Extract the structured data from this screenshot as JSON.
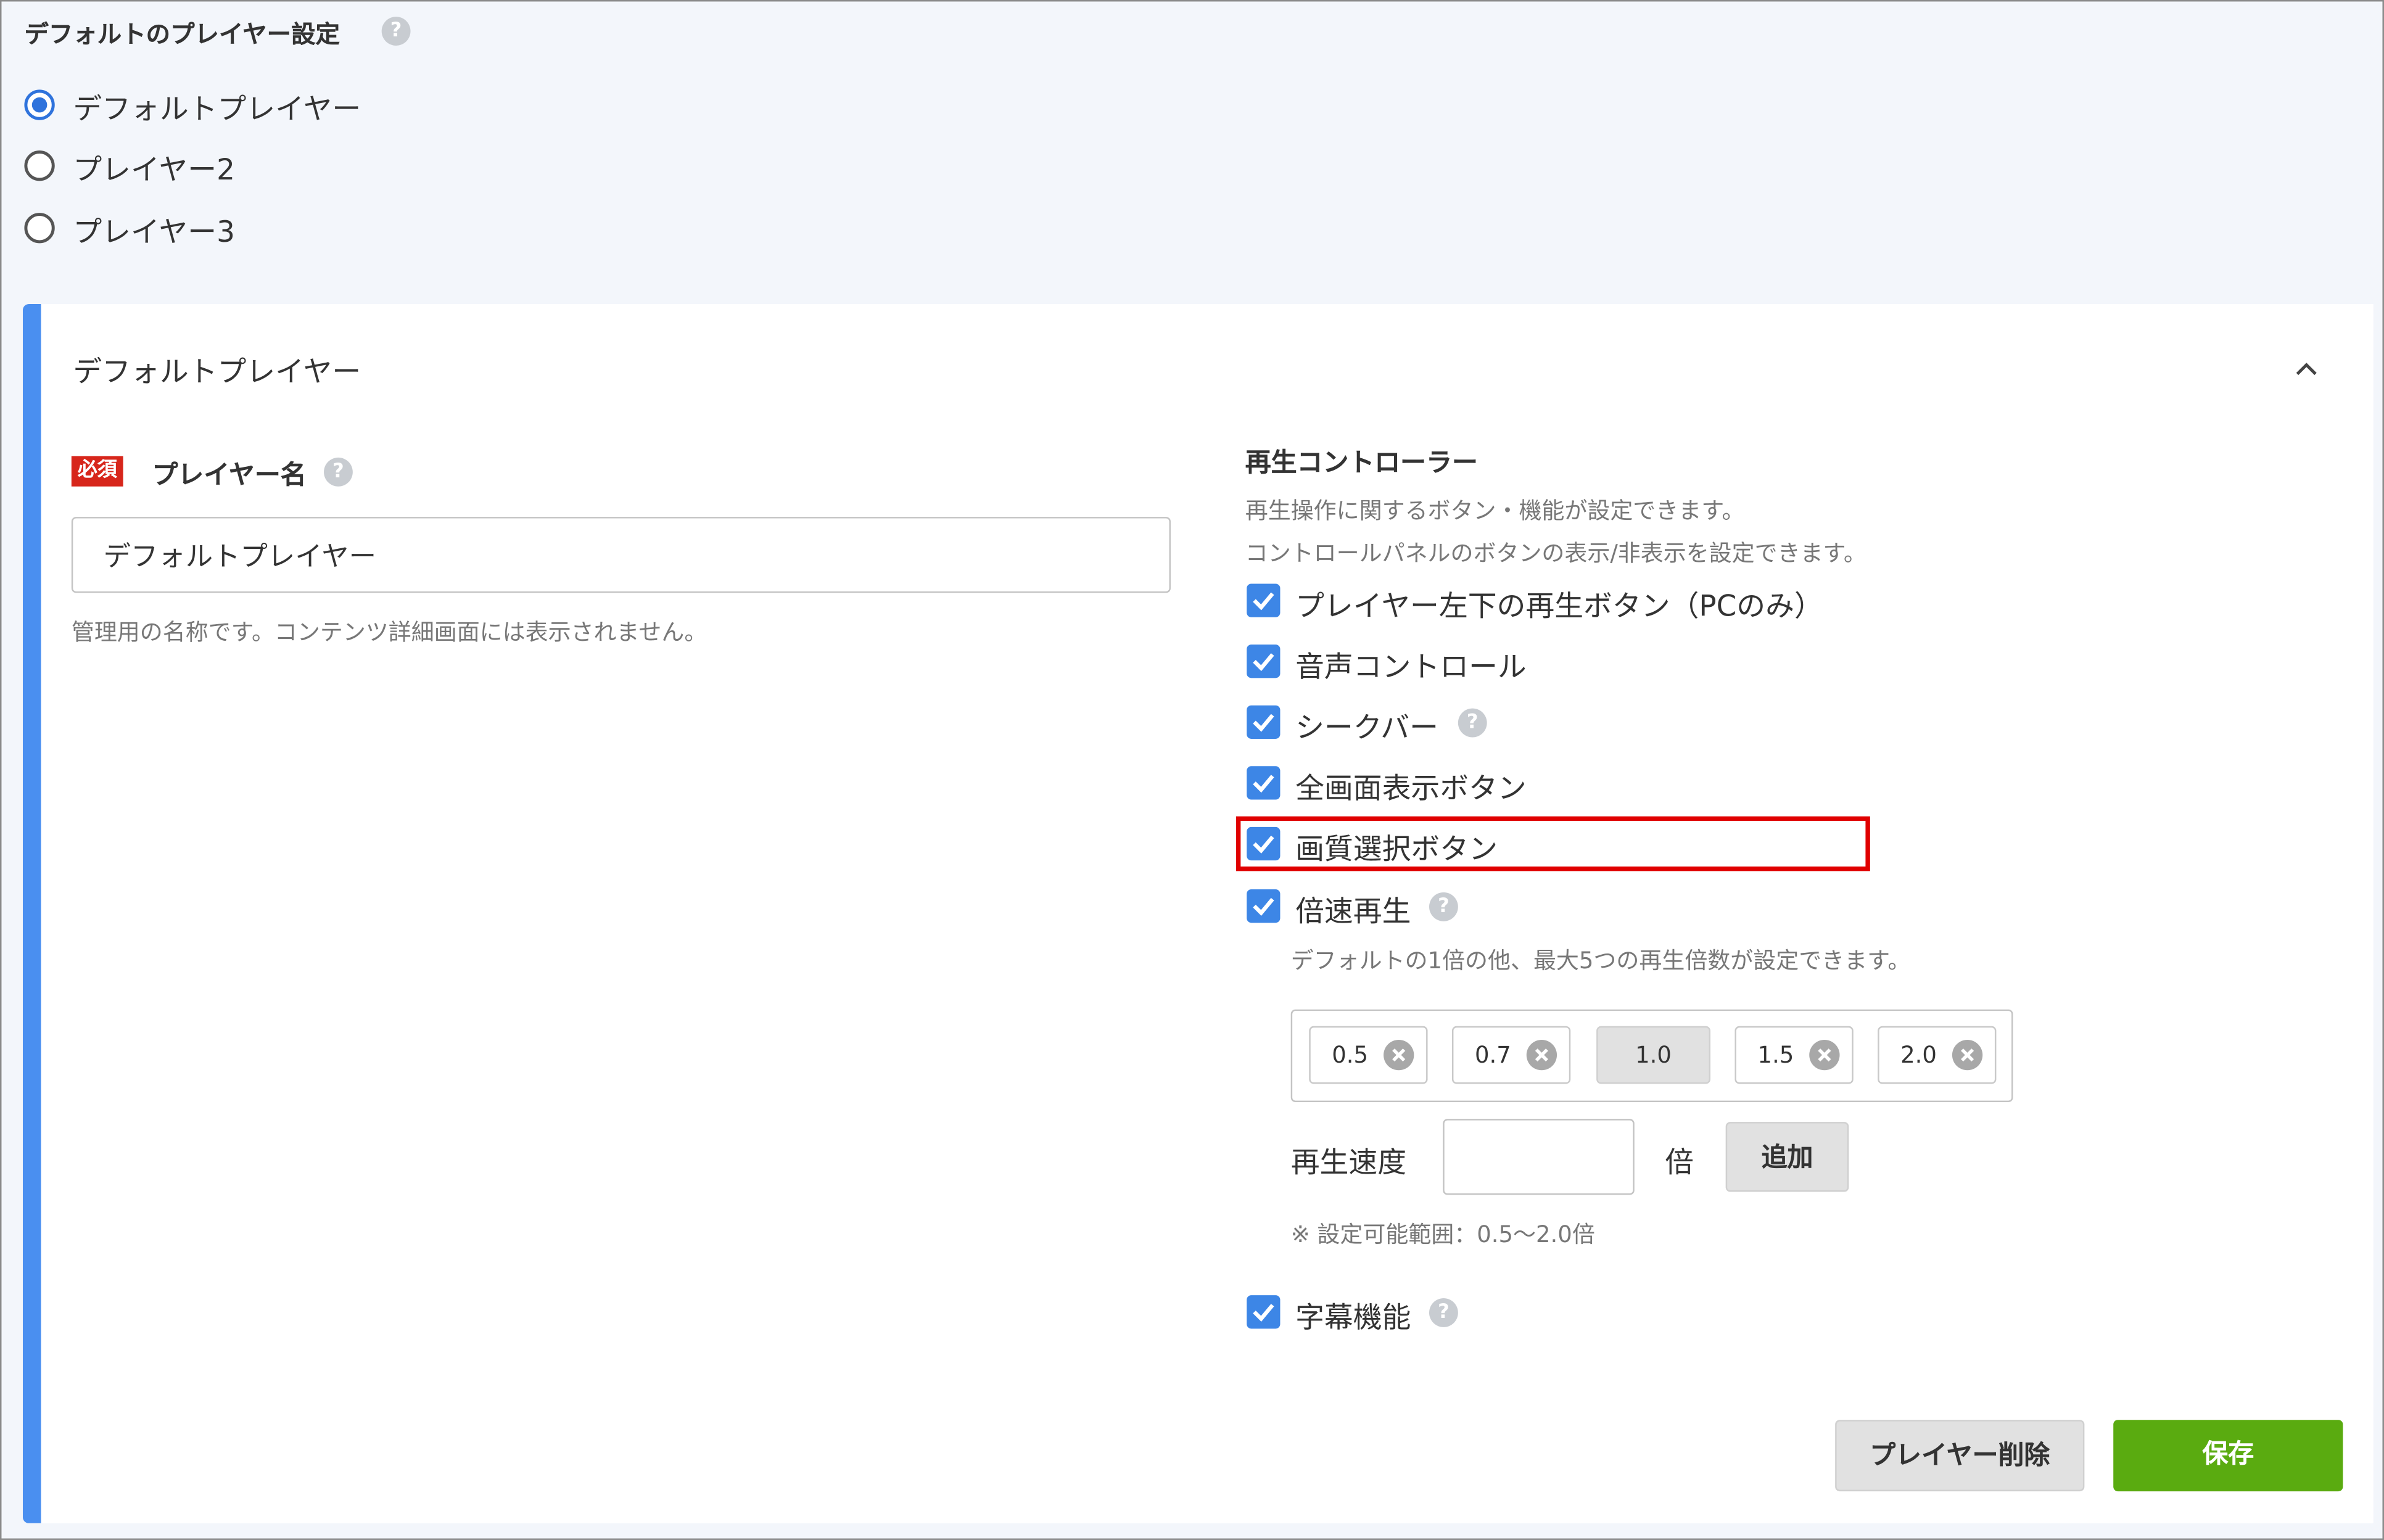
{
  "colors": {
    "accent": "#2f73dc",
    "panel_bar": "#4a8ff0",
    "checkbox": "#3d86e6",
    "required_badge": "#d7261b",
    "save_button": "#5aab10",
    "highlight": "#e00000"
  },
  "settings": {
    "title": "デフォルトのプレイヤー設定",
    "help": "?",
    "options": [
      {
        "label": "デフォルトプレイヤー",
        "selected": true
      },
      {
        "label": "プレイヤー2",
        "selected": false
      },
      {
        "label": "プレイヤー3",
        "selected": false
      }
    ]
  },
  "panel": {
    "title": "デフォルトプレイヤー",
    "collapse_icon": "chevron-up-icon",
    "name_field": {
      "required_badge": "必須",
      "label": "プレイヤー名",
      "value": "デフォルトプレイヤー",
      "hint": "管理用の名称です。コンテンツ詳細画面には表示されません。"
    },
    "controller": {
      "title": "再生コントローラー",
      "desc1": "再生操作に関するボタン・機能が設定できます。",
      "desc2": "コントロールパネルのボタンの表示/非表示を設定できます。",
      "items": [
        {
          "label": "プレイヤー左下の再生ボタン（PCのみ）",
          "checked": true
        },
        {
          "label": "音声コントロール",
          "checked": true
        },
        {
          "label": "シークバー",
          "checked": true
        },
        {
          "label": "全画面表示ボタン",
          "checked": true
        },
        {
          "label": "画質選択ボタン",
          "checked": true
        },
        {
          "label": "倍速再生",
          "checked": true
        }
      ],
      "speed": {
        "desc": "デフォルトの1倍の他、最大5つの再生倍数が設定できます。",
        "chips": [
          "0.5",
          "0.7",
          "1.0",
          "1.5",
          "2.0"
        ],
        "input_label": "再生速度",
        "input_value": "",
        "unit": "倍",
        "add_label": "追加",
        "range_note": "※ 設定可能範囲：0.5〜2.0倍"
      },
      "subtitle": {
        "label": "字幕機能",
        "checked": true
      }
    },
    "delete_label": "プレイヤー削除",
    "save_label": "保存"
  }
}
